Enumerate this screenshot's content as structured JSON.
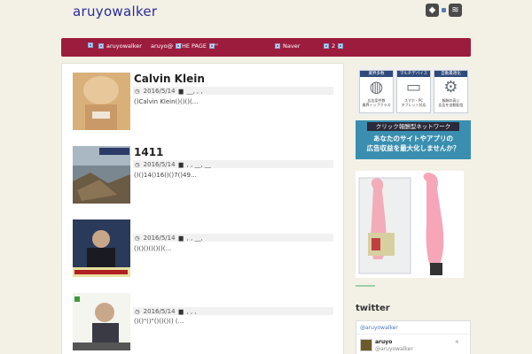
{
  "header": {
    "site_title": "aruyowalker",
    "icons": [
      "feedly-icon",
      "rss-icon"
    ]
  },
  "nav": {
    "items": [
      {
        "label": ""
      },
      {
        "label": "aruyowalker"
      },
      {
        "label": "aruyo@"
      },
      {
        "label": "THE PAGE"
      },
      {
        "label": "\"\""
      },
      {
        "label": "Naver"
      },
      {
        "label": "2"
      }
    ]
  },
  "posts": [
    {
      "title": "Calvin Klein",
      "date": "2016/5/14",
      "categories": "__, , ,",
      "excerpt": "()Calvin Klein()()()(..."
    },
    {
      "title": "1411",
      "date": "2016/5/14",
      "categories": ", , __, __",
      "excerpt": "()()14()16()()7()49..."
    },
    {
      "title": "",
      "date": "2016/5/14",
      "categories": ", , __,",
      "excerpt": "()()()()()()(..."
    },
    {
      "title": "",
      "date": "2016/5/14",
      "categories": ", , ,",
      "excerpt": "()()\"()\"()()()() (..."
    }
  ],
  "sidebar": {
    "features": [
      {
        "head": "業界多数",
        "icon": "globe-icon",
        "text1": "広告案件数",
        "text2": "業界トップクラス"
      },
      {
        "head": "マルチデバイス",
        "icon": "devices-icon",
        "text1": "スマホ・PC",
        "text2": "タブレット対応"
      },
      {
        "head": "自動最適化",
        "icon": "gears-icon",
        "text1": "報酬の高い",
        "text2": "広告を自動配信"
      }
    ],
    "banner_top": "クリック報酬型ネットワーク",
    "banner_line1": "あなたのサイトやアプリの",
    "banner_line2": "広告収益を最大化しませんか？",
    "twitter_heading": "twitter",
    "twitter_link": "@aruyowalker",
    "twitter_name": "aruyo",
    "twitter_handle": "@aruyowalker"
  },
  "colors": {
    "nav_bg": "#9c1c3e",
    "title": "#2a2a9a",
    "page_bg": "#f3f1e6"
  }
}
